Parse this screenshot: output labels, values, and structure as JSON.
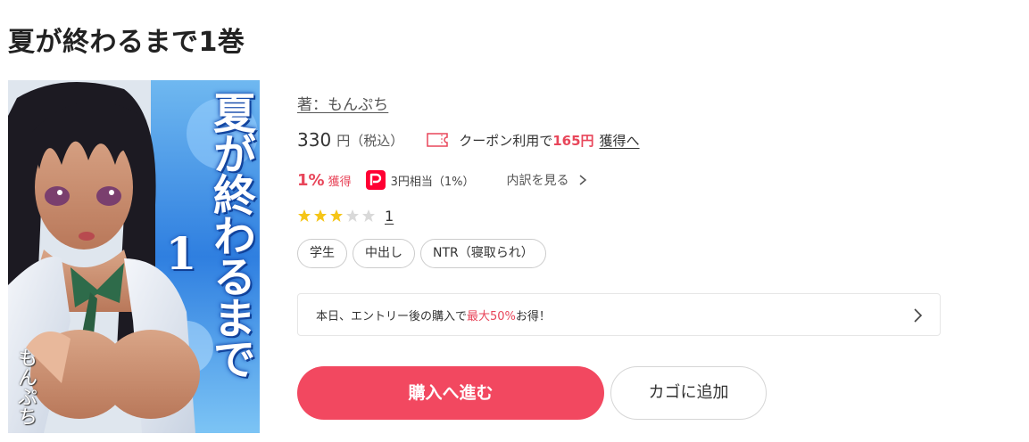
{
  "page_title": "夏が終わるまで1巻",
  "cover": {
    "title_text": "夏が終わるまで",
    "volume_text": "1",
    "author_text": "もんぷち"
  },
  "author": {
    "prefix": "著：",
    "name": "もんぷち"
  },
  "price": {
    "amount": "330",
    "unit": "円（税込）"
  },
  "coupon": {
    "icon": "coupon-ticket-icon",
    "lead": "クーポン利用で",
    "amount": "165円",
    "link": "獲得へ"
  },
  "points": {
    "percent": "1%",
    "get_label": "獲得",
    "icon": "paypay-icon",
    "equivalent": "3円相当（1%）",
    "breakdown_label": "内訳を見る"
  },
  "rating": {
    "stars": 3,
    "max_stars": 5,
    "review_count": "1"
  },
  "tags": [
    "学生",
    "中出し",
    "NTR（寝取られ）"
  ],
  "campaign": {
    "lead": "本日、エントリー後の購入で",
    "highlight": "最大50%",
    "tail": "お得！"
  },
  "buttons": {
    "buy": "購入へ進む",
    "cart": "カゴに追加"
  },
  "colors": {
    "accent": "#f24860",
    "point_red": "#e8465a",
    "star_on": "#f5c518",
    "star_off": "#d9d9d9"
  }
}
